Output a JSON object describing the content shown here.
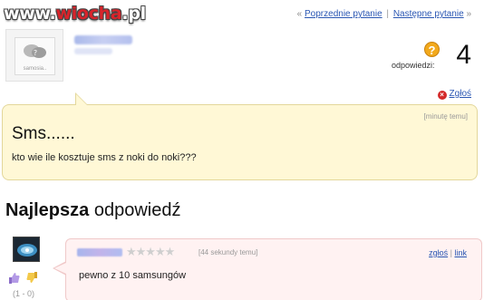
{
  "watermark": {
    "part1": "www.",
    "part2": "wiocha",
    "part3": ".pl"
  },
  "nav": {
    "prefix": "«",
    "prev": "Poprzednie pytanie",
    "separator": "|",
    "next": "Następne pytanie",
    "suffix": "»"
  },
  "asker": {
    "avatar_caption": "samosia.."
  },
  "answers_count": {
    "label": "odpowiedzi:",
    "value": "4",
    "icon": "question-icon"
  },
  "report": {
    "label": "Zgłoś"
  },
  "question": {
    "time": "[minutę temu]",
    "title": "Sms......",
    "body": "kto wie ile kosztuje sms z noki do noki???"
  },
  "best_answer": {
    "heading_bold": "Najlepsza",
    "heading_rest": "odpowiedź",
    "stars": "★★★★★",
    "time": "[44 sekundy temu]",
    "report_label": "zgłoś",
    "link_sep": "|",
    "link_label": "link",
    "text": "pewno z 10 samsungów",
    "votes": "(1 - 0)"
  },
  "colors": {
    "question_bg": "#fff8d6",
    "answer_bg": "#fff2f2",
    "link": "#2b57b3",
    "watermark_accent": "#d8242b"
  }
}
